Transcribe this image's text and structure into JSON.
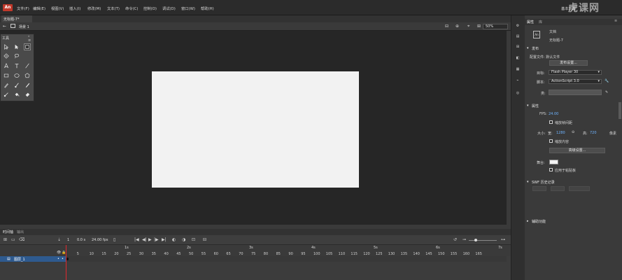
{
  "app": {
    "logo": "An",
    "menu": [
      "文件(F)",
      "编辑(E)",
      "视图(V)",
      "插入(I)",
      "修改(M)",
      "文本(T)",
      "命令(C)",
      "控制(O)",
      "调试(D)",
      "窗口(W)",
      "帮助(H)"
    ],
    "workspace": "基本功能",
    "watermark": "虎课网"
  },
  "document": {
    "tab": "无标题-7*",
    "scene": "场景 1",
    "zoom": "50%"
  },
  "tools": {
    "title": "工具"
  },
  "timeline": {
    "tab_timeline": "时间轴",
    "tab_output": "输出",
    "current_frame": "1",
    "time": "0.0 s",
    "fps": "24.00 fps",
    "frame_ticks": [
      "5",
      "10",
      "15",
      "20",
      "25",
      "30",
      "35",
      "40",
      "45",
      "50",
      "55",
      "60",
      "65",
      "70",
      "75",
      "80",
      "85",
      "90",
      "95",
      "100",
      "105",
      "110",
      "115",
      "120",
      "125",
      "130",
      "135",
      "140",
      "145",
      "150",
      "155",
      "160",
      "165"
    ],
    "second_marks": [
      "1s",
      "2s",
      "3s",
      "4s",
      "5s",
      "6s",
      "7s"
    ],
    "layer_name": "图层_1"
  },
  "properties": {
    "tab_props": "属性",
    "tab_library": "库",
    "doc_type": "文档",
    "doc_name": "无标题-7",
    "publish_section": "发布",
    "profile_label": "配置文件: 默认文件",
    "publish_settings_btn": "发布设置...",
    "target_label": "目标:",
    "target_value": "Flash Player 30",
    "script_label": "脚本:",
    "script_value": "ActionScript 3.0",
    "class_label": "类:",
    "properties_section": "属性",
    "fps_label": "FPS:",
    "fps_value": "24.00",
    "scale_spans_label": "缩放帧间距",
    "size_label": "大小:",
    "width_label": "宽:",
    "width_value": "1280",
    "height_label": "高:",
    "height_value": "720",
    "unit": "像素",
    "scale_content_label": "缩放内容",
    "advanced_btn": "高级设置...",
    "stage_label": "舞台:",
    "stage_color": "#f2f2f2",
    "apply_pasteboard_label": "应用于粘贴板",
    "swf_history_section": "SWF 历史记录",
    "accessibility_section": "辅助功能"
  },
  "colors": {
    "playhead": "#e0282e",
    "layer_highlight": "#2e5a8f",
    "stage": "#f2f2f2"
  }
}
